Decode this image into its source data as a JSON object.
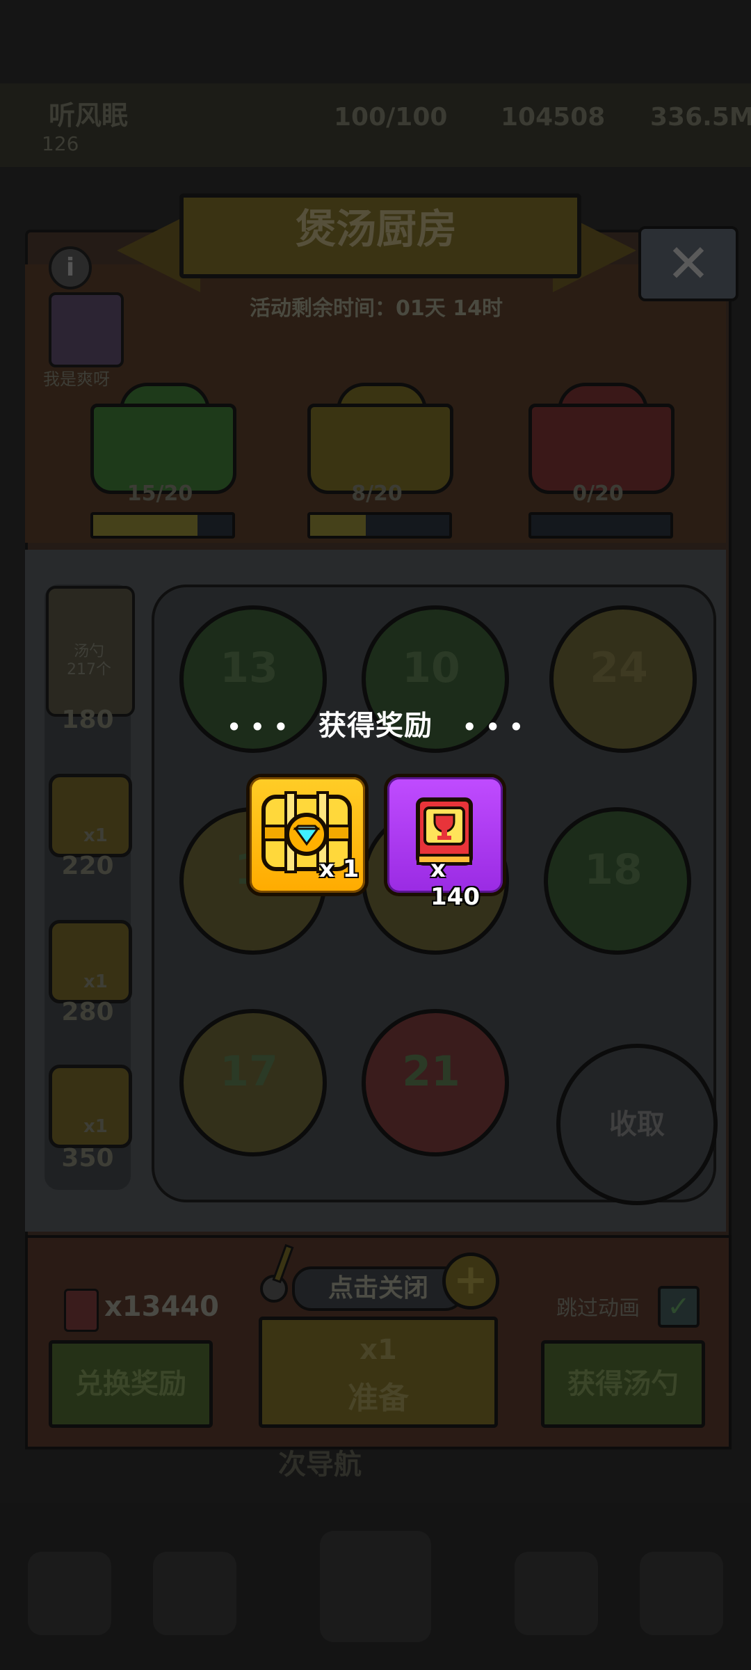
{
  "header": {
    "player_name": "听风眠",
    "player_level": "126",
    "energy": "100/100",
    "gold": "104508",
    "cash": "336.5M"
  },
  "event": {
    "title": "煲汤厨房",
    "timer": "活动剩余时间：01天 14时",
    "character_label": "我是爽呀",
    "pots": [
      {
        "count": "15/20",
        "fill": 0.75,
        "color": "#1e3a1a"
      },
      {
        "count": "8/20",
        "fill": 0.4,
        "color": "#3a3412"
      },
      {
        "count": "0/20",
        "fill": 0.0,
        "color": "#3a1818"
      }
    ]
  },
  "ladle": {
    "label": "汤勺",
    "count": "217个",
    "milestones": [
      "180",
      "220",
      "280",
      "350"
    ],
    "milestone_qty": [
      "x1",
      "x1",
      "x1",
      "x1"
    ]
  },
  "grid": {
    "pots": [
      {
        "num": "13",
        "color": "#1c2c1a"
      },
      {
        "num": "10",
        "color": "#1c2c1a"
      },
      {
        "num": "24",
        "color": "#33301a"
      },
      {
        "num": "1",
        "color": "#33301a"
      },
      {
        "num": "",
        "color": "#33301a"
      },
      {
        "num": "18",
        "color": "#1c2c1a"
      },
      {
        "num": "17",
        "color": "#33301a"
      },
      {
        "num": "21",
        "color": "#3a1c1c"
      }
    ],
    "collect": "收取"
  },
  "controls": {
    "tokens": "x13440",
    "redeem": "兑换奖励",
    "tap_close": "点击关闭",
    "prepare_qty": "x1",
    "prepare": "准备",
    "skip": "跳过动画",
    "get_ladle": "获得汤勺",
    "below": "次导航"
  },
  "reward": {
    "title": "获得奖励",
    "dots_left": "• • •",
    "dots_right": "• • •",
    "items": [
      {
        "icon": "diamond-chest-icon",
        "qty": "x 1"
      },
      {
        "icon": "trophy-book-icon",
        "qty": "x 140"
      }
    ]
  }
}
